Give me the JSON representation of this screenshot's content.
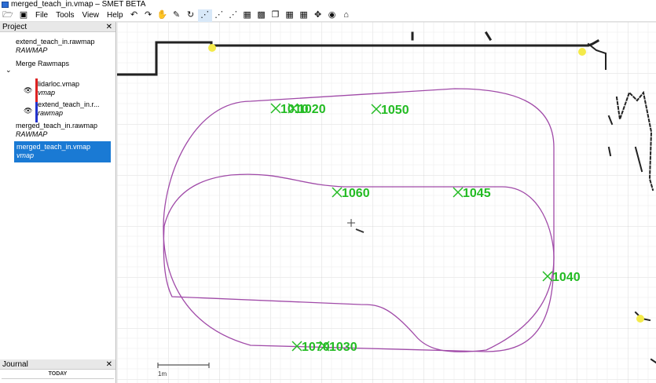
{
  "window": {
    "title": "merged_teach_in.vmap – SMET  BETA"
  },
  "menu": {
    "file": "File",
    "tools": "Tools",
    "view": "View",
    "help": "Help"
  },
  "toolbar": {
    "icons": [
      "undo-icon",
      "redo-icon",
      "hand-icon",
      "pencil-icon",
      "rotate-icon",
      "path-node-icon",
      "path-add-icon",
      "path-edit-icon",
      "grid-select-icon",
      "grid-erase-icon",
      "copy-icon",
      "grid-add-icon",
      "grid-remove-icon",
      "move-icon",
      "eye-icon",
      "home-icon"
    ]
  },
  "project": {
    "header": "Project",
    "items": [
      {
        "title": "extend_teach_in.rawmap",
        "subtitle": "RAWMAP"
      },
      {
        "title": "Merge Rawmaps",
        "subtitle": ""
      },
      {
        "title": "lidarloc.vmap",
        "subtitle": "vmap",
        "bar_color": "#dd2222"
      },
      {
        "title": "extend_teach_in.r...",
        "subtitle": "rawmap",
        "bar_color": "#2233cc"
      },
      {
        "title": "merged_teach_in.rawmap",
        "subtitle": "RAWMAP"
      },
      {
        "title": "merged_teach_in.vmap",
        "subtitle": "vmap",
        "selected": true
      }
    ]
  },
  "journal": {
    "header": "Journal",
    "today_label": "TODAY"
  },
  "map": {
    "route_color": "#a04aa8",
    "label_color": "#22bb22",
    "stations": [
      "1010",
      "1020",
      "1050",
      "1060",
      "1045",
      "1040",
      "1070",
      "1030"
    ],
    "scale_label": "1m"
  }
}
